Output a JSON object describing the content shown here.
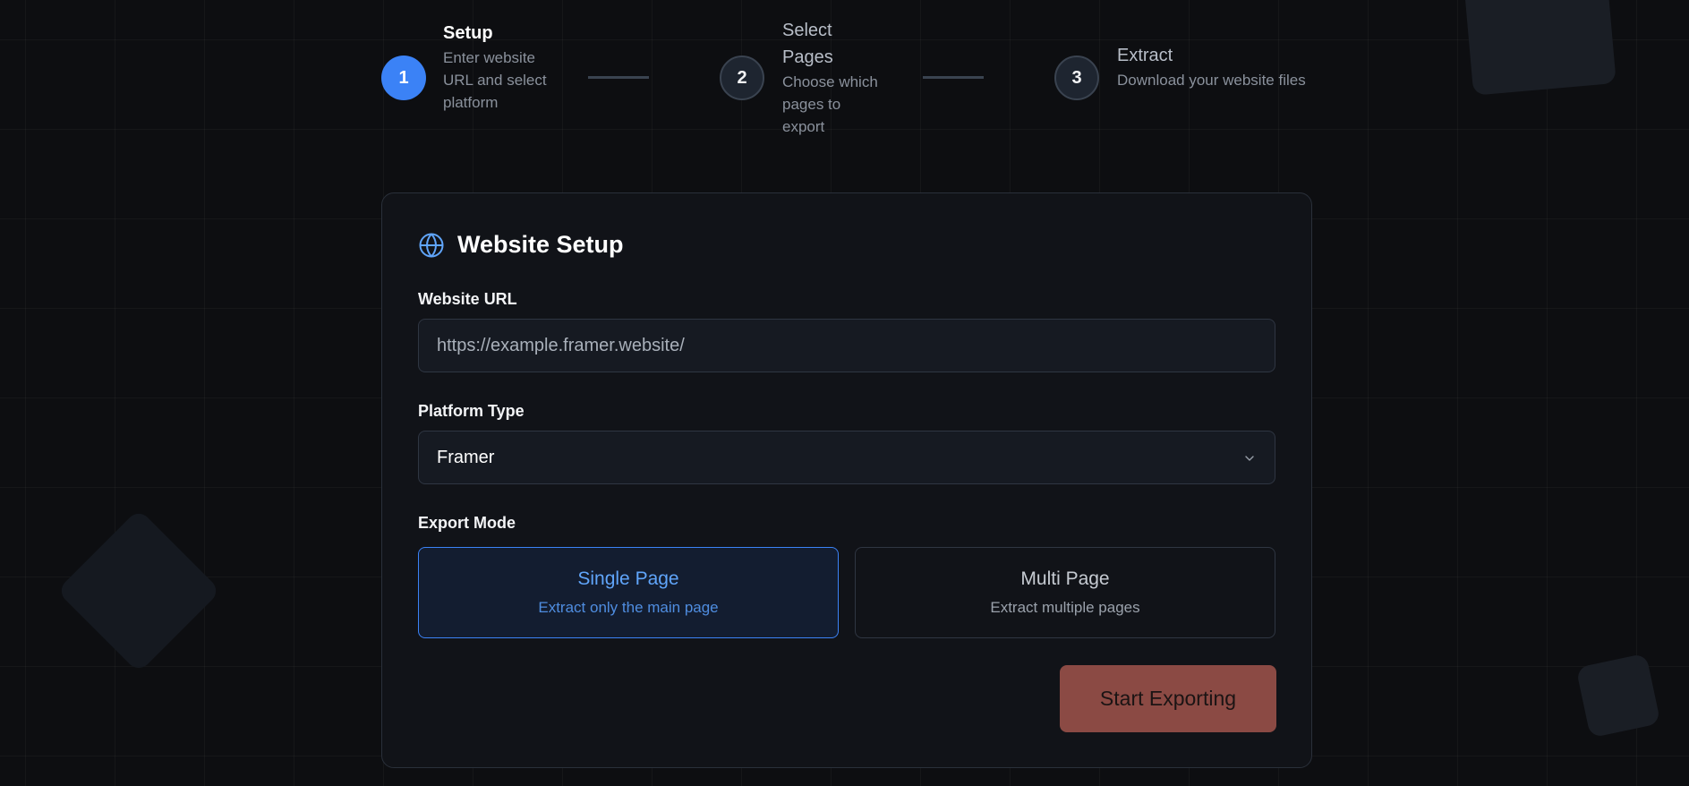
{
  "stepper": {
    "steps": [
      {
        "number": "1",
        "title": "Setup",
        "description": "Enter website URL and select platform",
        "state": "active"
      },
      {
        "number": "2",
        "title": "Select Pages",
        "description": "Choose which pages to export",
        "state": "inactive"
      },
      {
        "number": "3",
        "title": "Extract",
        "description": "Download your website files",
        "state": "inactive"
      }
    ]
  },
  "card": {
    "title": "Website Setup",
    "icon": "globe-icon",
    "url_label": "Website URL",
    "url_placeholder": "https://example.framer.website/",
    "url_value": "",
    "platform_label": "Platform Type",
    "platform_selected": "Framer",
    "mode_label": "Export Mode",
    "modes": [
      {
        "title": "Single Page",
        "description": "Extract only the main page",
        "selected": true
      },
      {
        "title": "Multi Page",
        "description": "Extract multiple pages",
        "selected": false
      }
    ],
    "start_button": "Start Exporting"
  },
  "colors": {
    "accent": "#3b82f6",
    "background": "#0d0e11",
    "card": "#111318",
    "start_button": "#8b4a44"
  }
}
